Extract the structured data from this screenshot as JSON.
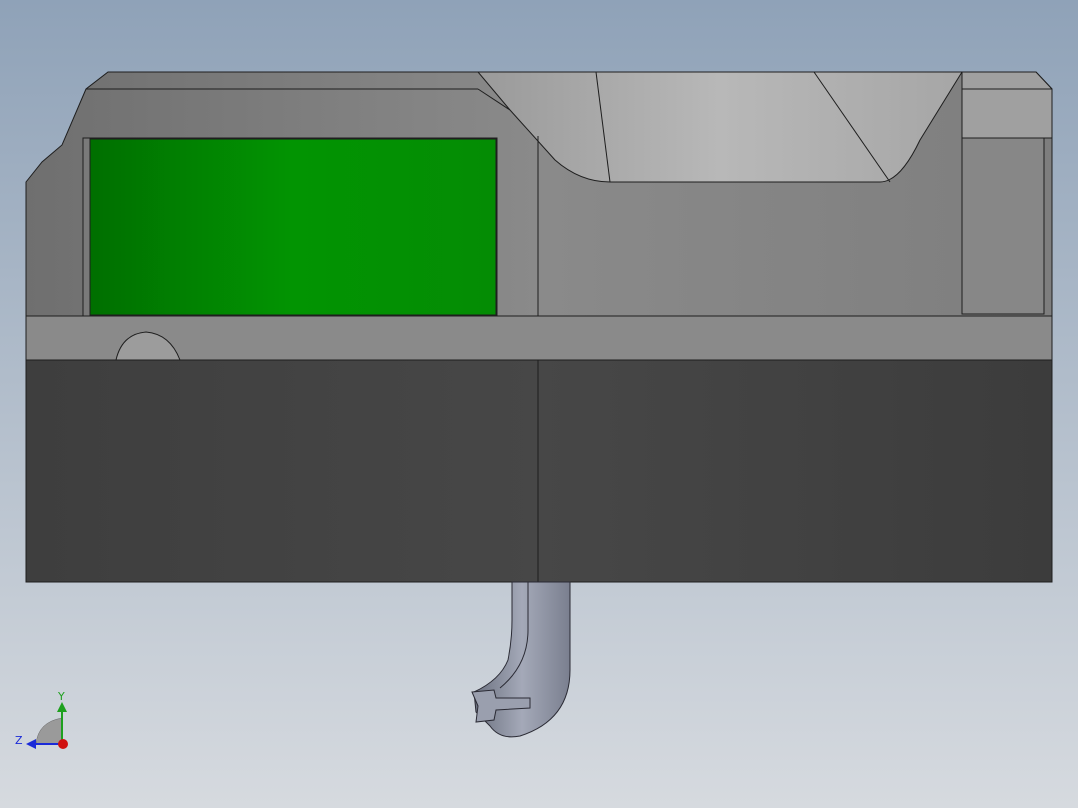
{
  "viewport": {
    "background_top": "#8fa2b8",
    "background_bottom": "#d6dadf"
  },
  "model": {
    "upper_body_color": "#8a8a8a",
    "lower_body_color": "#454545",
    "insert_color": "#0b8f0b",
    "rail_color": "#8c8c8c",
    "pipe_color": "#8a8f9f"
  },
  "triad": {
    "y_label": "Y",
    "z_label": "Z",
    "y_color": "#1ea01e",
    "z_color": "#1a2ad8",
    "x_color": "#d01010"
  }
}
